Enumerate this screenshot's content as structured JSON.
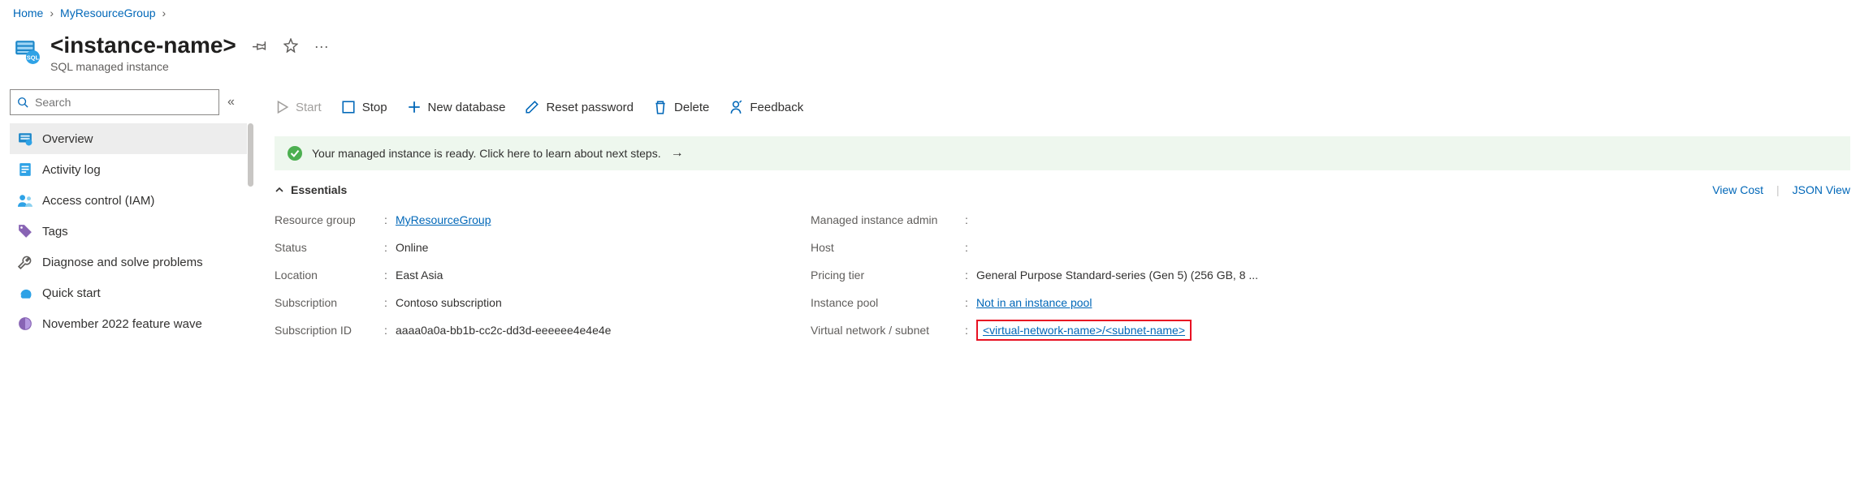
{
  "breadcrumb": {
    "home": "Home",
    "group": "MyResourceGroup"
  },
  "header": {
    "title": "<instance-name>",
    "subtitle": "SQL managed instance"
  },
  "search": {
    "placeholder": "Search"
  },
  "sidebar": {
    "items": [
      {
        "label": "Overview"
      },
      {
        "label": "Activity log"
      },
      {
        "label": "Access control (IAM)"
      },
      {
        "label": "Tags"
      },
      {
        "label": "Diagnose and solve problems"
      },
      {
        "label": "Quick start"
      },
      {
        "label": "November 2022 feature wave"
      }
    ]
  },
  "toolbar": {
    "start": "Start",
    "stop": "Stop",
    "newdb": "New database",
    "reset": "Reset password",
    "delete": "Delete",
    "feedback": "Feedback"
  },
  "info": {
    "message": "Your managed instance is ready. Click here to learn about next steps."
  },
  "essentials": {
    "header": "Essentials",
    "viewcost": "View Cost",
    "jsonview": "JSON View",
    "left": {
      "rg_label": "Resource group",
      "rg_value": "MyResourceGroup",
      "status_label": "Status",
      "status_value": "Online",
      "location_label": "Location",
      "location_value": "East Asia",
      "sub_label": "Subscription",
      "sub_value": "Contoso subscription",
      "subid_label": "Subscription ID",
      "subid_value": "aaaa0a0a-bb1b-cc2c-dd3d-eeeeee4e4e4e"
    },
    "right": {
      "admin_label": "Managed instance admin",
      "admin_value": "",
      "host_label": "Host",
      "host_value": "",
      "tier_label": "Pricing tier",
      "tier_value": "General Purpose Standard-series (Gen 5) (256 GB, 8 ...",
      "pool_label": "Instance pool",
      "pool_value": "Not in an instance pool",
      "vnet_label": "Virtual network / subnet",
      "vnet_value": "<virtual-network-name>/<subnet-name>"
    }
  }
}
